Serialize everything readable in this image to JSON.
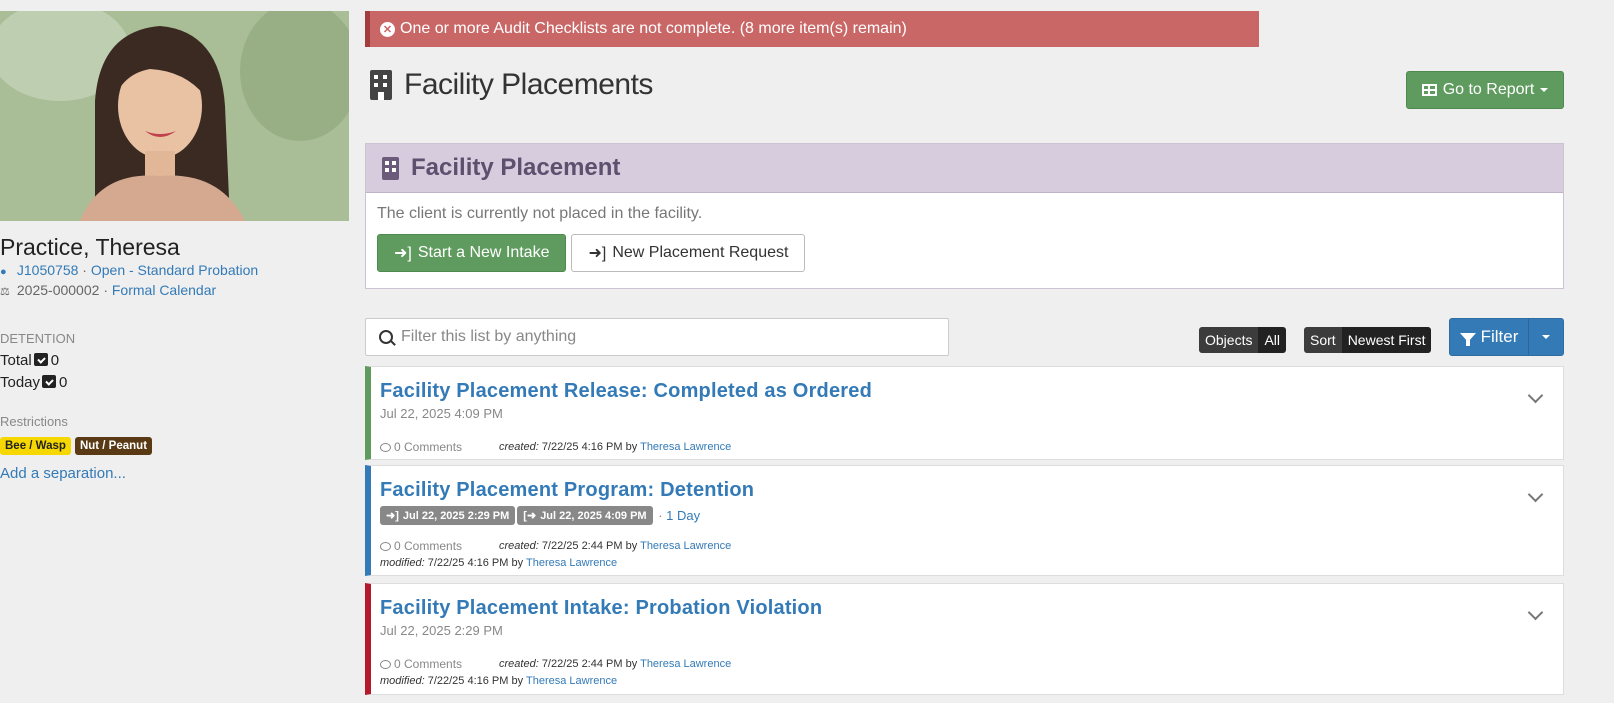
{
  "alert": {
    "text": "One or more Audit Checklists are not complete. (8 more item(s) remain)"
  },
  "page": {
    "title": "Facility Placements",
    "report_button": "Go to Report"
  },
  "client": {
    "name": "Practice, Theresa",
    "id": "J1050758",
    "status": "Open - Standard Probation",
    "case_number": "2025-000002",
    "calendar": "Formal Calendar"
  },
  "detention": {
    "label": "DETENTION",
    "total_label": "Total",
    "total": "0",
    "today_label": "Today",
    "today": "0"
  },
  "restrictions": {
    "label": "Restrictions",
    "tags": [
      "Bee / Wasp",
      "Nut / Peanut"
    ],
    "add_link": "Add a separation..."
  },
  "panel": {
    "title": "Facility Placement",
    "message": "The client is currently not placed in the facility.",
    "start_intake": "Start a New Intake",
    "new_request": "New Placement Request"
  },
  "toolbar": {
    "search_placeholder": "Filter this list by anything",
    "objects_label": "Objects",
    "objects_value": "All",
    "sort_label": "Sort",
    "sort_value": "Newest First",
    "filter_label": "Filter"
  },
  "cards": [
    {
      "title": "Facility Placement Release: Completed as Ordered",
      "date": "Jul 22, 2025 4:09 PM",
      "comments": "0 Comments",
      "created_label": "created:",
      "created": "7/22/25 4:16 PM",
      "by": "by",
      "created_by": "Theresa Lawrence",
      "accent": "#5f9b5e"
    },
    {
      "title": "Facility Placement Program: Detention",
      "start": "Jul 22, 2025 2:29 PM",
      "end": "Jul 22, 2025 4:09 PM",
      "duration": "1 Day",
      "comments": "0 Comments",
      "created_label": "created:",
      "created": "7/22/25 2:44 PM",
      "by": "by",
      "created_by": "Theresa Lawrence",
      "modified_label": "modified:",
      "modified": "7/22/25 4:16 PM",
      "modified_by": "Theresa Lawrence",
      "accent": "#337ab7"
    },
    {
      "title": "Facility Placement Intake: Probation Violation",
      "date": "Jul 22, 2025 2:29 PM",
      "comments": "0 Comments",
      "created_label": "created:",
      "created": "7/22/25 2:44 PM",
      "by": "by",
      "created_by": "Theresa Lawrence",
      "modified_label": "modified:",
      "modified": "7/22/25 4:16 PM",
      "modified_by": "Theresa Lawrence",
      "accent": "#b5192b"
    }
  ]
}
